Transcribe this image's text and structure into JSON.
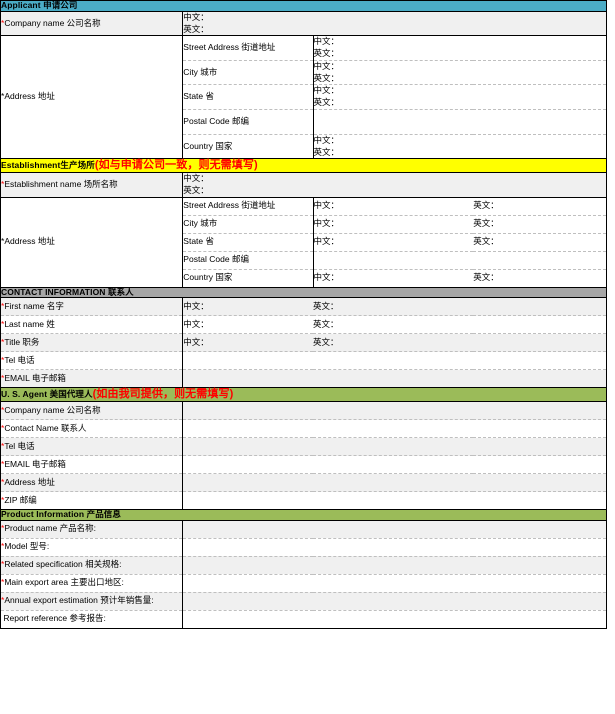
{
  "document": {
    "type": "registration-form",
    "colors": {
      "applicant_header_bg": "#4BACC6",
      "establishment_header_bg": "#FFFF00",
      "contact_header_bg": "#A6A6A6",
      "agent_header_bg": "#9BBB59",
      "product_header_bg": "#9BBB59",
      "required_marker": "#FF0000",
      "note_text": "#FF0000",
      "row_shade": "#F0F0F0"
    },
    "labels": {
      "chinese_prefix": "中文：",
      "english_prefix": "英文："
    }
  },
  "applicant": {
    "header_en": "Applicant ",
    "header_cn": "申请公司",
    "company_name_label": "Company name 公司名称",
    "company_name_cn": "中文：",
    "company_name_en": "英文：",
    "address_label": "Address 地址",
    "address_rows": [
      {
        "sub": "Street Address  街道地址",
        "cn": "中文：",
        "en": "英文：",
        "two_line": true
      },
      {
        "sub": "City  城市",
        "cn": "中文：",
        "en": "英文：",
        "two_line": true
      },
      {
        "sub": "State  省",
        "cn": "中文：",
        "en": "英文：",
        "two_line": true
      },
      {
        "sub": "Postal Code  邮编",
        "cn": "",
        "en": "",
        "two_line": false
      },
      {
        "sub": "Country  国家",
        "cn": "中文：",
        "en": "英文：",
        "two_line": true
      }
    ]
  },
  "establishment": {
    "header_en": "Establishment",
    "header_cn": "生产场所",
    "header_note": "(如与申请公司一致，则无需填写)",
    "name_label": "Establishment name 场所名称",
    "name_cn": "中文：",
    "name_en": "英文：",
    "address_label": "Address  地址",
    "address_rows": [
      {
        "sub": "Street Address  街道地址",
        "cn": "中文：",
        "en": "英文："
      },
      {
        "sub": "City  城市",
        "cn": "中文：",
        "en": "英文："
      },
      {
        "sub": "State  省",
        "cn": "中文：",
        "en": "英文："
      },
      {
        "sub": "Postal Code  邮编",
        "cn": "",
        "en": ""
      },
      {
        "sub": "Country  国家",
        "cn": "中文：",
        "en": "英文："
      }
    ]
  },
  "contact": {
    "header_en": "CONTACT INFORMATION ",
    "header_cn": "联系人",
    "rows": [
      {
        "label": "First name  名字",
        "required": true,
        "cn": "中文：",
        "en": "英文："
      },
      {
        "label": "Last name  姓",
        "required": true,
        "cn": "中文：",
        "en": "英文："
      },
      {
        "label": "Title  职务",
        "required": true,
        "cn": "中文：",
        "en": "英文："
      },
      {
        "label": "Tel  电话",
        "required": true,
        "cn": "",
        "en": ""
      },
      {
        "label": "EMAIL  电子邮箱",
        "required": true,
        "cn": "",
        "en": ""
      }
    ]
  },
  "us_agent": {
    "header_en": "U. S. Agent ",
    "header_cn": "美国代理人",
    "header_note": "(如由我司提供，则无需填写)",
    "rows": [
      {
        "label": "Company name 公司名称",
        "required": true,
        "value": ""
      },
      {
        "label": "Contact Name 联系人",
        "required": true,
        "value": ""
      },
      {
        "label": "Tel  电话",
        "required": true,
        "value": ""
      },
      {
        "label": "EMAIL 电子邮箱",
        "required": true,
        "value": ""
      },
      {
        "label": "Address  地址",
        "required": true,
        "value": ""
      },
      {
        "label": "ZIP 邮编",
        "required": true,
        "value": ""
      }
    ]
  },
  "product": {
    "header_en": "Product Information ",
    "header_cn": "产品信息",
    "rows": [
      {
        "label": "Product name 产品名称:",
        "required": true,
        "value": ""
      },
      {
        "label": "Model 型号:",
        "required": true,
        "value": ""
      },
      {
        "label": "Related specification 相关规格:",
        "required": true,
        "value": ""
      },
      {
        "label": "Main export area 主要出口地区:",
        "required": true,
        "value": ""
      },
      {
        "label": "Annual export estimation 预计年销售量:",
        "required": true,
        "value": ""
      },
      {
        "label": "Report reference 参考报告:",
        "required": false,
        "value": ""
      }
    ]
  }
}
